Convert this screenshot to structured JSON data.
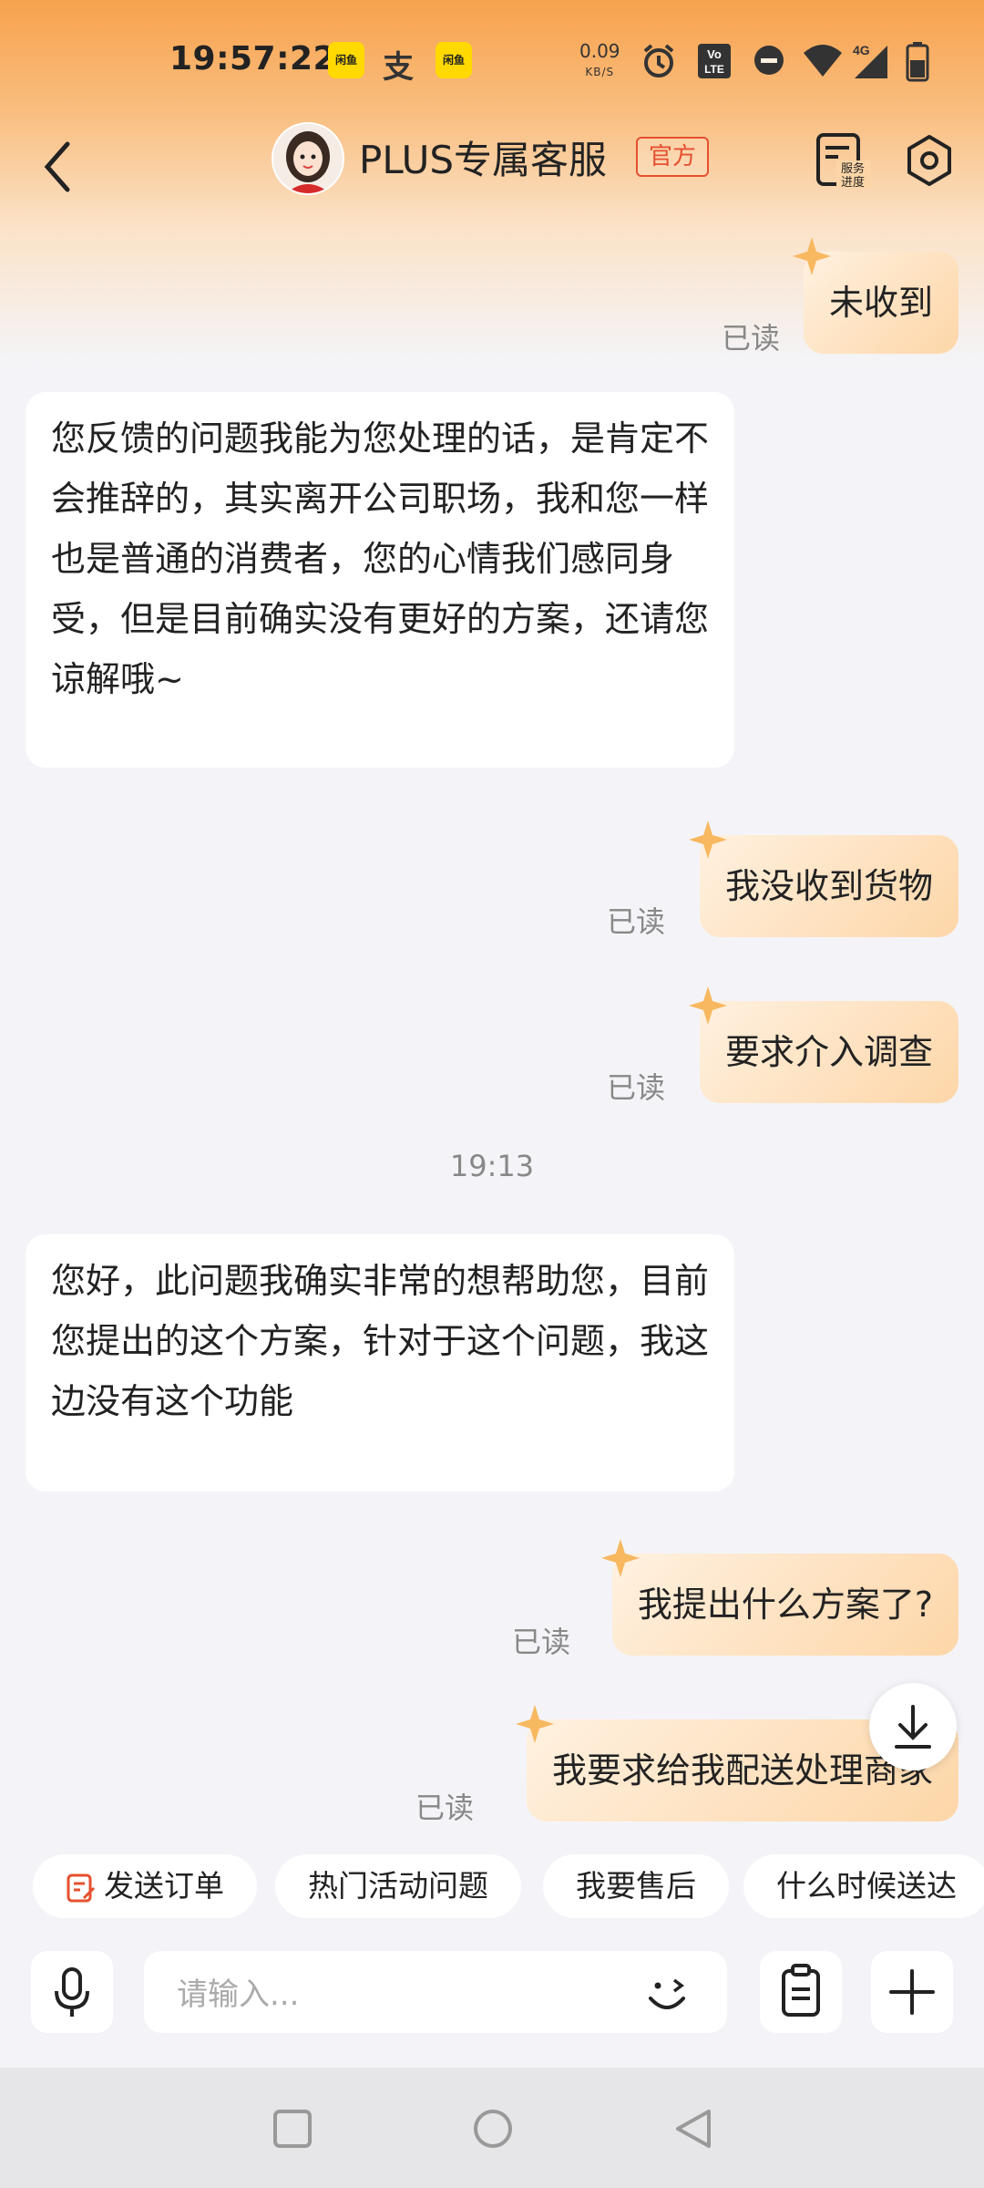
{
  "status_bar": {
    "time": "19:57:22",
    "app_icon_label": "闲鱼",
    "alipay_glyph": "支",
    "net_rate": "0.09",
    "net_unit": "KB/S",
    "volte": "Vo LTE",
    "network": "4G",
    "icons": [
      "alarm-icon",
      "volte-icon",
      "dnd-icon",
      "wifi-icon",
      "signal-icon",
      "battery-icon"
    ]
  },
  "header": {
    "title": "PLUS专属客服",
    "badge": "官方",
    "service_progress": "服务进度"
  },
  "messages": {
    "m1": {
      "text": "未收到",
      "read": "已读"
    },
    "m2": {
      "text": "您反馈的问题我能为您处理的话，是肯定不会推辞的，其实离开公司职场，我和您一样也是普通的消费者，您的心情我们感同身受，但是目前确实没有更好的方案，还请您谅解哦~"
    },
    "m3": {
      "text": "我没收到货物",
      "read": "已读"
    },
    "m4": {
      "text": "要求介入调查",
      "read": "已读"
    },
    "timestamp": "19:13",
    "m5": {
      "text": "您好，此问题我确实非常的想帮助您，目前您提出的这个方案，针对于这个问题，我这边没有这个功能"
    },
    "m6": {
      "text": "我提出什么方案了?",
      "read": "已读"
    },
    "m7": {
      "text": "我要求给我配送处理商家",
      "read": "已读"
    }
  },
  "quick_replies": [
    "发送订单",
    "热门活动问题",
    "我要售后",
    "什么时候送达"
  ],
  "input": {
    "placeholder": "请输入..."
  },
  "colors": {
    "accent_orange": "#f7a24d",
    "badge_red": "#e5502f",
    "bubble_out": "#fdd6a8"
  }
}
